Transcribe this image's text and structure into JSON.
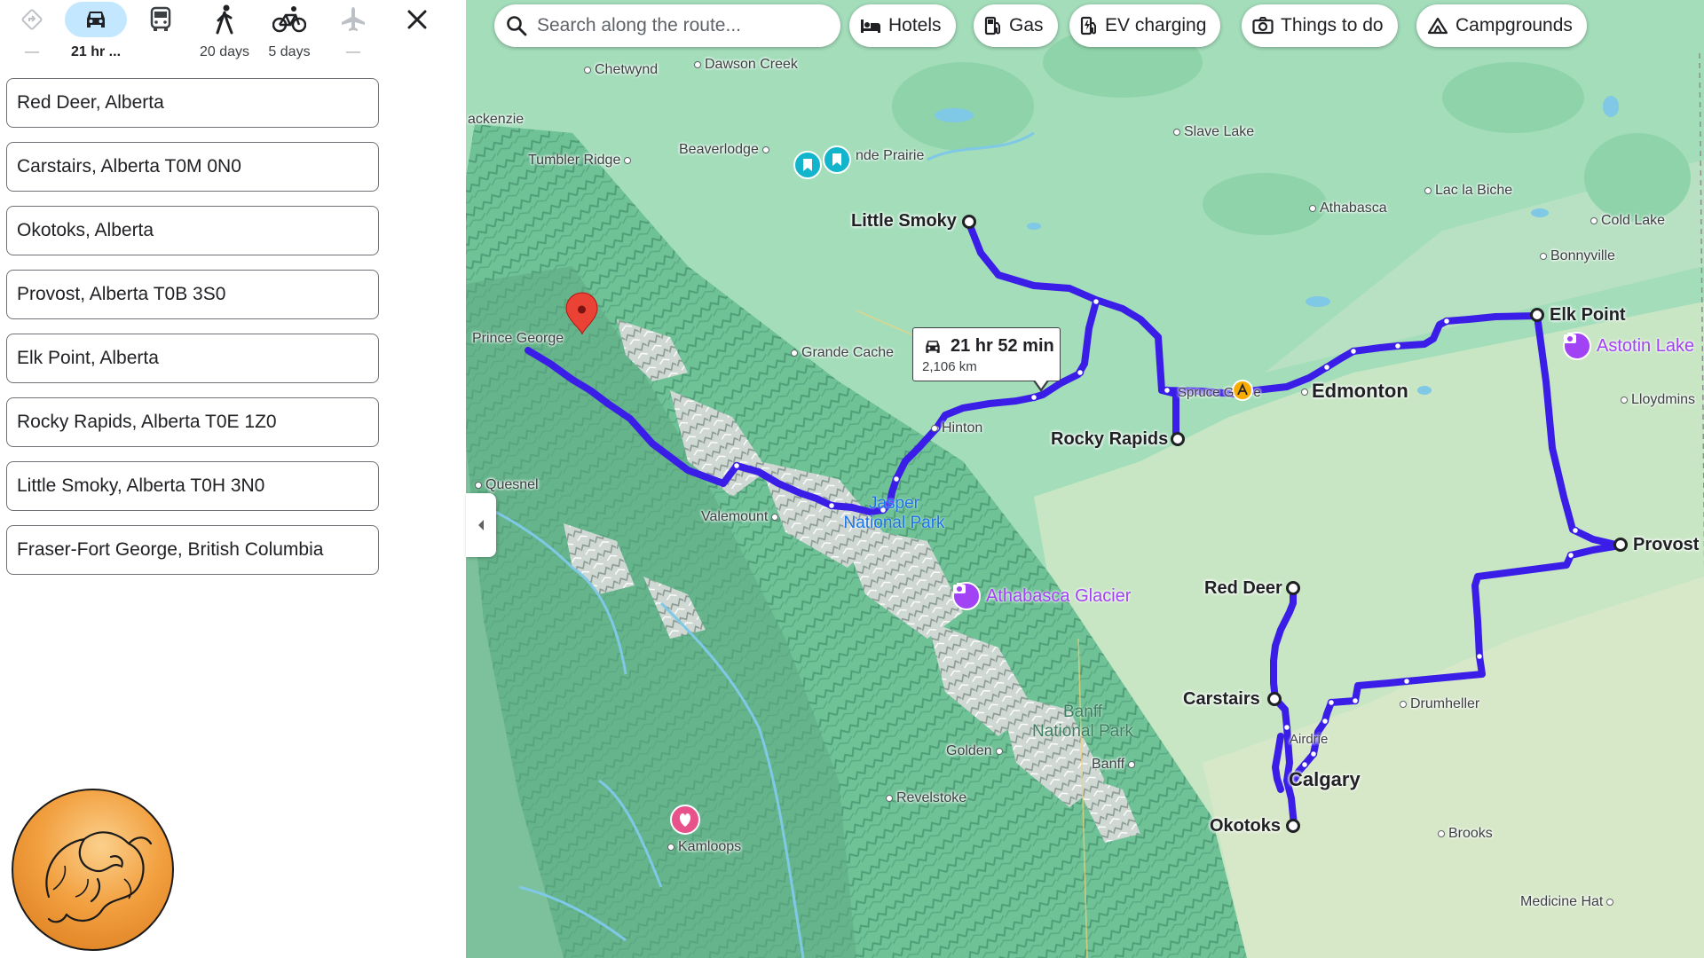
{
  "travel_modes": [
    {
      "name": "best",
      "icon": "directions-icon",
      "label": "—"
    },
    {
      "name": "driving",
      "icon": "car-icon",
      "label": "21 hr ...",
      "active": true
    },
    {
      "name": "transit",
      "icon": "bus-icon",
      "label": ""
    },
    {
      "name": "walking",
      "icon": "walk-icon",
      "label": "20 days"
    },
    {
      "name": "cycling",
      "icon": "bicycle-icon",
      "label": "5 days"
    },
    {
      "name": "flights",
      "icon": "plane-icon",
      "label": "—"
    }
  ],
  "stops": [
    "Red Deer, Alberta",
    "Carstairs, Alberta T0M 0N0",
    "Okotoks, Alberta",
    "Provost, Alberta T0B 3S0",
    "Elk Point, Alberta",
    "Rocky Rapids, Alberta T0E 1Z0",
    "Little Smoky, Alberta T0H 3N0",
    "Fraser-Fort George, British Columbia"
  ],
  "search": {
    "placeholder": "Search along the route..."
  },
  "chips": [
    "Hotels",
    "Gas",
    "EV charging",
    "Things to do",
    "Campgrounds"
  ],
  "route_summary": {
    "time": "21 hr 52 min",
    "distance": "2,106 km"
  },
  "route_color": "#3a1ee8",
  "stop_labels": {
    "little_smoky": "Little Smoky",
    "elk_point": "Elk Point",
    "rocky_rapids": "Rocky Rapids",
    "provost": "Provost",
    "red_deer": "Red Deer",
    "carstairs": "Carstairs",
    "okotoks": "Okotoks"
  },
  "places": {
    "chetwynd": "Chetwynd",
    "dawson_creek": "Dawson Creek",
    "mackenzie": "ackenzie",
    "slave_lake": "Slave Lake",
    "tumbler_ridge": "Tumbler Ridge",
    "beaverlodge": "Beaverlodge",
    "grande_prairie": "nde Prairie",
    "lac_la_biche": "Lac la Biche",
    "athabasca": "Athabasca",
    "cold_lake": "Cold Lake",
    "bonnyville": "Bonnyville",
    "prince_george": "Prince George",
    "grande_cache": "Grande Cache",
    "spruce_grove": "Spruce G",
    "spruce_grove_tail": "e",
    "edmonton": "Edmonton",
    "lloydminster": "Lloydmins",
    "hinton": "Hinton",
    "quesnel": "Quesnel",
    "valemount": "Valemount",
    "drumheller": "Drumheller",
    "airdrie": "Airdrie",
    "calgary": "Calgary",
    "golden": "Golden",
    "banff": "Banff",
    "revelstoke": "Revelstoke",
    "kamloops": "Kamloops",
    "brooks": "Brooks",
    "medicine_hat": "Medicine Hat"
  },
  "parks": {
    "jasper": "Jasper\nNational Park",
    "banff": "Banff\nNational Park"
  },
  "pois": {
    "astotin_lake": "Astotin Lake",
    "athabasca_glacier": "Athabasca Glacier"
  }
}
